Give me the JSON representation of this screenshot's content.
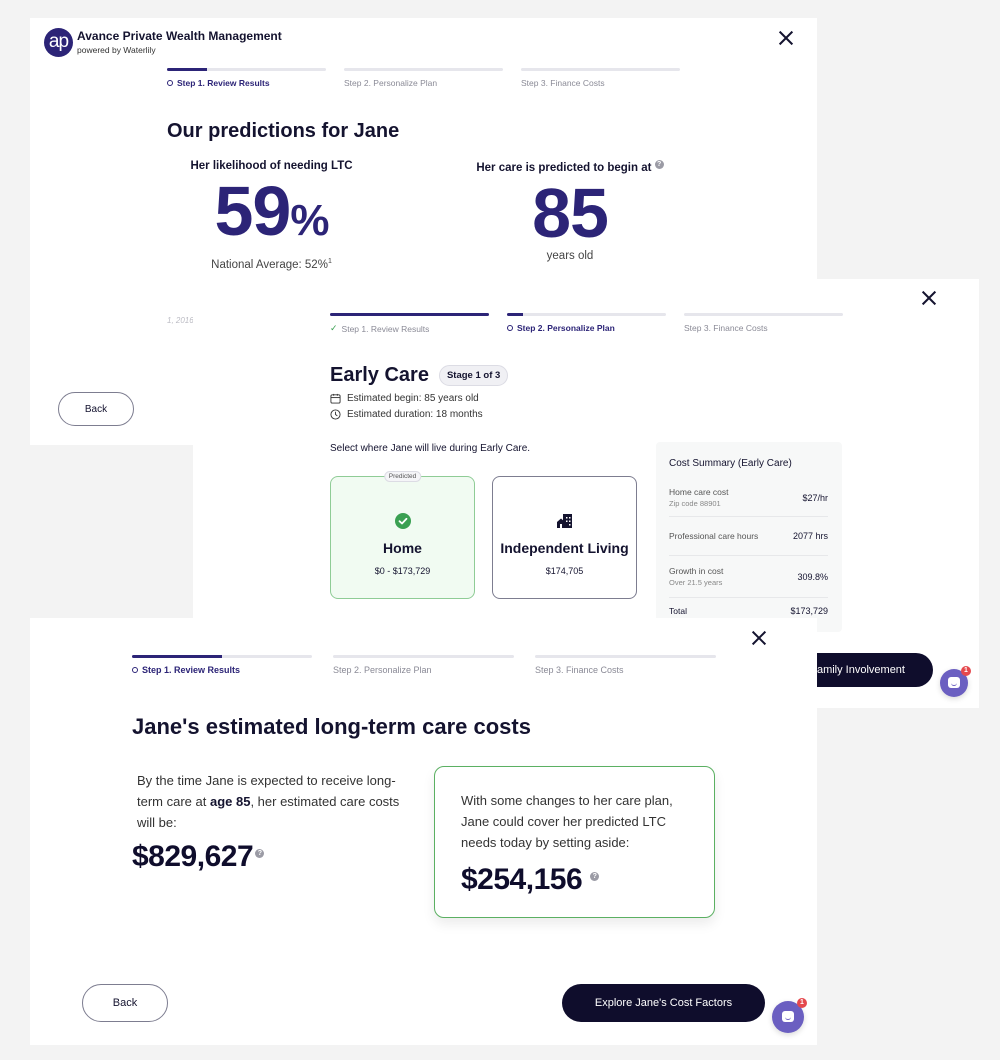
{
  "panel1": {
    "brand": {
      "logo_text": "ap",
      "name": "Avance Private Wealth Management",
      "subtitle": "powered by Waterlily"
    },
    "steps": [
      {
        "label": "Step 1. Review Results",
        "state": "active",
        "progress": 0.25
      },
      {
        "label": "Step 2. Personalize Plan",
        "state": "pending",
        "progress": 0
      },
      {
        "label": "Step 3. Finance Costs",
        "state": "pending",
        "progress": 0
      }
    ],
    "title": "Our predictions for Jane",
    "likelihood": {
      "question": "Her likelihood of needing LTC",
      "value": "59",
      "unit": "%",
      "sub": "National Average: 52%",
      "footnote_mark": "1"
    },
    "care_begin": {
      "question": "Her care is predicted to begin at",
      "value": "85",
      "sub": "years old"
    },
    "footnote": "1, 2016",
    "back_label": "Back"
  },
  "panel2": {
    "steps": [
      {
        "label": "Step 1. Review Results",
        "state": "done",
        "progress": 1
      },
      {
        "label": "Step 2. Personalize Plan",
        "state": "active",
        "progress": 0.1
      },
      {
        "label": "Step 3. Finance Costs",
        "state": "pending",
        "progress": 0
      }
    ],
    "title": "Early Care",
    "stage_badge": "Stage 1 of 3",
    "estimated_begin": "Estimated begin: 85 years old",
    "estimated_duration": "Estimated duration: 18 months",
    "select_prompt": "Select where Jane will live during Early Care.",
    "options": [
      {
        "tag": "Predicted",
        "title": "Home",
        "price": "$0 - $173,729",
        "selected": true
      },
      {
        "title": "Independent Living",
        "price": "$174,705",
        "selected": false
      }
    ],
    "summary": {
      "heading": "Cost Summary (Early Care)",
      "rows": [
        {
          "label": "Home care cost",
          "sub": "Zip code 88901",
          "value": "$27/hr"
        },
        {
          "label": "Professional care hours",
          "sub": "",
          "value": "2077 hrs"
        },
        {
          "label": "Growth in cost",
          "sub": "Over 21.5 years",
          "value": "309.8%"
        },
        {
          "label": "Total",
          "sub": "",
          "value": "$173,729"
        }
      ]
    },
    "next_label": "Family Involvement",
    "chat_count": "1"
  },
  "panel3": {
    "steps": [
      {
        "label": "Step 1. Review Results",
        "state": "active",
        "progress": 0.5
      },
      {
        "label": "Step 2. Personalize Plan",
        "state": "pending",
        "progress": 0
      },
      {
        "label": "Step 3. Finance Costs",
        "state": "pending",
        "progress": 0
      }
    ],
    "title": "Jane's estimated long-term care costs",
    "left_text_pre": "By the time Jane is expected to receive long-term care at ",
    "left_text_bold": "age 85",
    "left_text_post": ", her estimated care costs will be:",
    "total_cost": "$829,627",
    "card_text": "With some changes to her care plan, Jane could cover her predicted LTC needs today by setting aside:",
    "savings": "$254,156",
    "back_label": "Back",
    "next_label": "Explore Jane's Cost Factors",
    "chat_count": "1"
  }
}
